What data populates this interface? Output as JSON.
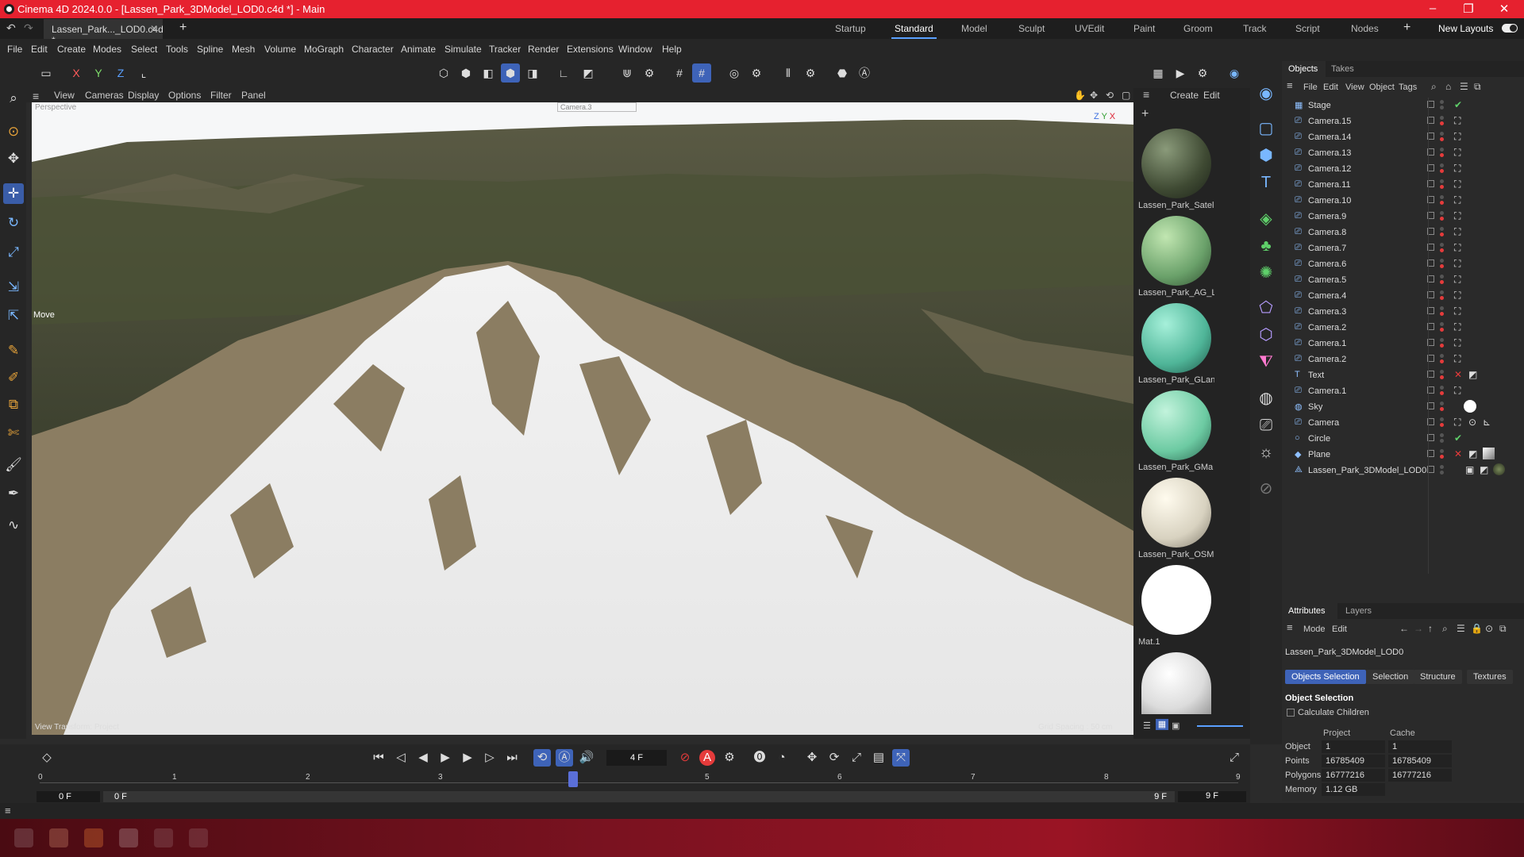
{
  "titlebar": {
    "title": "Cinema 4D 2024.0.0 - [Lassen_Park_3DModel_LOD0.c4d *] - Main"
  },
  "doc_tab": {
    "label": "Lassen_Park..._LOD0.c4d *"
  },
  "layout_tabs": [
    "Startup",
    "Standard",
    "Model",
    "Sculpt",
    "UVEdit",
    "Paint",
    "Groom",
    "Track",
    "Script",
    "Nodes"
  ],
  "new_layouts": "New Layouts",
  "menu": [
    "File",
    "Edit",
    "Create",
    "Modes",
    "Select",
    "Tools",
    "Spline",
    "Mesh",
    "Volume",
    "MoGraph",
    "Character",
    "Animate",
    "Simulate",
    "Tracker",
    "Render",
    "Extensions",
    "Window",
    "Help"
  ],
  "axis_buttons": [
    "X",
    "Y",
    "Z"
  ],
  "viewport": {
    "menu": [
      "View",
      "Cameras",
      "Display",
      "Options",
      "Filter",
      "Panel"
    ],
    "camera_label": "Perspective",
    "default_camera": "Camera.3",
    "tool_label": "Move",
    "view_transform": "View Transform: Project",
    "grid_spacing": "Grid Spacing : 50 cm"
  },
  "materials": {
    "menu": [
      "Create",
      "Edit"
    ],
    "items": [
      {
        "label": "Lassen_Park_Satel",
        "color": "#3f4a33"
      },
      {
        "label": "Lassen_Park_AG_L",
        "color": "#6aa16a"
      },
      {
        "label": "Lassen_Park_GLan",
        "color": "#4fb598"
      },
      {
        "label": "Lassen_Park_GMa",
        "color": "#6ccaa2"
      },
      {
        "label": "Lassen_Park_OSM",
        "color": "#d8d2c0"
      },
      {
        "label": "Mat.1",
        "color": "#ffffff"
      },
      {
        "label": "",
        "color": "#eeeeee"
      }
    ]
  },
  "objects_panel": {
    "tabs": [
      "Objects",
      "Takes"
    ],
    "menu": [
      "File",
      "Edit",
      "View",
      "Object",
      "Tags"
    ],
    "rows": [
      {
        "name": "Stage",
        "icon": "stage-icon"
      },
      {
        "name": "Camera.15",
        "icon": "camera-icon"
      },
      {
        "name": "Camera.14",
        "icon": "camera-icon"
      },
      {
        "name": "Camera.13",
        "icon": "camera-icon"
      },
      {
        "name": "Camera.12",
        "icon": "camera-icon"
      },
      {
        "name": "Camera.11",
        "icon": "camera-icon"
      },
      {
        "name": "Camera.10",
        "icon": "camera-icon"
      },
      {
        "name": "Camera.9",
        "icon": "camera-icon"
      },
      {
        "name": "Camera.8",
        "icon": "camera-icon"
      },
      {
        "name": "Camera.7",
        "icon": "camera-icon"
      },
      {
        "name": "Camera.6",
        "icon": "camera-icon"
      },
      {
        "name": "Camera.5",
        "icon": "camera-icon"
      },
      {
        "name": "Camera.4",
        "icon": "camera-icon"
      },
      {
        "name": "Camera.3",
        "icon": "camera-icon"
      },
      {
        "name": "Camera.2",
        "icon": "camera-icon"
      },
      {
        "name": "Camera.1",
        "icon": "camera-icon"
      },
      {
        "name": "Camera.2",
        "icon": "camera-icon"
      },
      {
        "name": "Text",
        "icon": "text-icon"
      },
      {
        "name": "Camera.1",
        "icon": "camera-icon"
      },
      {
        "name": "Sky",
        "icon": "sky-icon"
      },
      {
        "name": "Camera",
        "icon": "camera-icon"
      },
      {
        "name": "Circle",
        "icon": "circle-icon"
      },
      {
        "name": "Plane",
        "icon": "plane-icon"
      },
      {
        "name": "Lassen_Park_3DModel_LOD0",
        "icon": "polygon-icon"
      }
    ]
  },
  "attributes": {
    "tabs": [
      "Attributes",
      "Layers"
    ],
    "menu": [
      "Mode",
      "Edit"
    ],
    "object_name": "Lassen_Park_3DModel_LOD0",
    "sub_tabs": [
      "Objects Selection",
      "Selection",
      "Structure",
      "Textures"
    ],
    "section_title": "Object Selection",
    "calc_children": "Calculate Children",
    "col_project": "Project",
    "col_cache": "Cache",
    "rows": [
      {
        "label": "Object",
        "project": "1",
        "cache": "1"
      },
      {
        "label": "Points",
        "project": "16785409",
        "cache": "16785409"
      },
      {
        "label": "Polygons",
        "project": "16777216",
        "cache": "16777216"
      },
      {
        "label": "Memory",
        "project": "1.12 GB",
        "cache": ""
      }
    ]
  },
  "timeline": {
    "current_frame": "4 F",
    "ticks": [
      "0",
      "1",
      "2",
      "3",
      "4",
      "5",
      "6",
      "7",
      "8",
      "9"
    ],
    "start_frame": "0 F",
    "range_start": "0 F",
    "range_end": "9 F",
    "end_frame": "9 F"
  }
}
